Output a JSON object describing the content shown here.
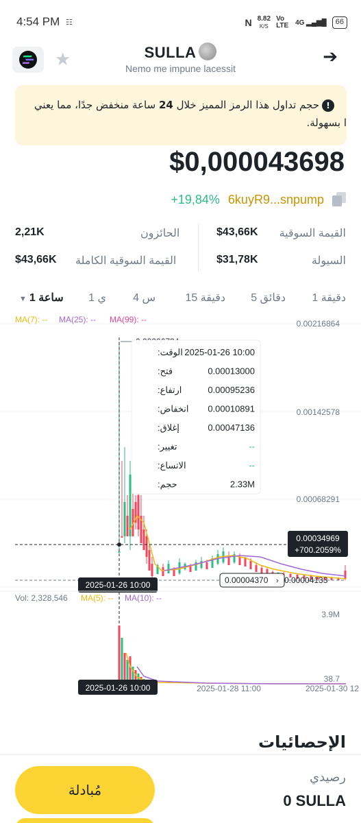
{
  "status": {
    "time": "4:54 PM",
    "speed": "8.82",
    "speed_unit": "K/S",
    "volte": "Vo LTE",
    "network": "4G",
    "battery": "66"
  },
  "header": {
    "title": "SULLA",
    "subtitle": "Nemo me impune lacessit"
  },
  "warning": {
    "text_part1": "حجم تداول هذا الرمز المميز خلال ",
    "highlight": "24",
    "text_part2": " ساعة منخفض جدًا، مما يعني",
    "line2": "ا بسهولة."
  },
  "price": "$0,000043698",
  "contract": {
    "address": "6kuyR9...snpump",
    "change": "+19,84%"
  },
  "stats": {
    "market_cap_label": "القيمة السوقية",
    "market_cap": "$43,66K",
    "holders_label": "الحائزون",
    "holders": "2,21K",
    "liquidity_label": "السيولة",
    "liquidity": "$31,78K",
    "fdv_label": "القيمة السوقية الكاملة",
    "fdv": "$43,66K"
  },
  "tabs": [
    "1 دقيقة",
    "5 دقائق",
    "15 دقيقة",
    "4 س",
    "1 ي",
    "1 ساعة"
  ],
  "chart": {
    "ma_labels": {
      "ma7": "MA(7): --",
      "ma25": "MA(25): --",
      "ma99": "MA(99): --"
    },
    "y_ticks": [
      "0.00216864",
      "0.00142578",
      "0.00068291"
    ],
    "high_label": "0.00206734",
    "current_price": "0.00034969",
    "current_change": "+700.2059%",
    "low_label": "0.00004370",
    "right_low": "0.00004133",
    "crosshair_time": "2025-01-26 10:00",
    "tooltip": [
      {
        "label": "الوقت:",
        "value": "2025-01-26 10:00"
      },
      {
        "label": "فتح:",
        "value": "0.00013000"
      },
      {
        "label": "ارتفاع:",
        "value": "0.00095236"
      },
      {
        "label": "انخفاض:",
        "value": "0.00010891"
      },
      {
        "label": "إغلاق:",
        "value": "0.00047136"
      },
      {
        "label": "تغيير:",
        "value": "--"
      },
      {
        "label": "الاتساع:",
        "value": "--"
      },
      {
        "label": "حجم:",
        "value": "2.33M"
      }
    ],
    "volume": {
      "label": "Vol: 2,328,546",
      "ma5": "MA(5): --",
      "ma10": "MA(10): --",
      "y_top": "3.9M",
      "y_bottom": "38.7"
    },
    "x_ticks": [
      "2025-01-26 10:00",
      "2025-01-28 11:00",
      "2025-01-30 12"
    ],
    "colors": {
      "up": "#2ebd85",
      "down": "#f6465d",
      "ma_yellow": "#f0b90b",
      "ma_purple": "#a367dc",
      "ma_pink": "#e84393"
    }
  },
  "section_title": "الإحصائيات",
  "bottom": {
    "swap_label": "مُبادلة",
    "balance_label": "رصيدي",
    "balance": "0 SULLA"
  }
}
